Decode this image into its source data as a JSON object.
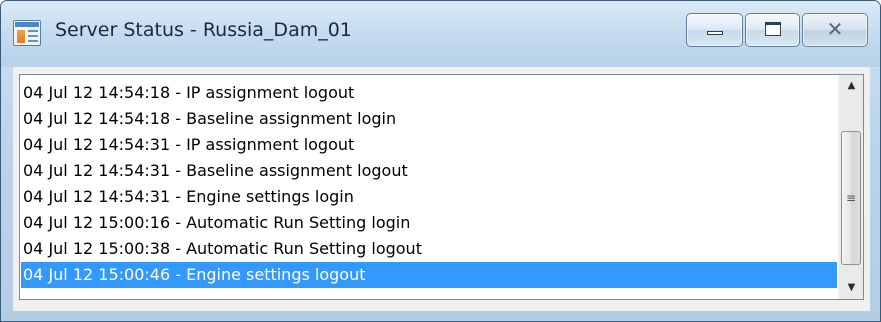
{
  "window": {
    "title": "Server Status - Russia_Dam_01",
    "icon": "application-window-icon",
    "controls": {
      "minimize_icon": "minimize-icon",
      "maximize_icon": "maximize-icon",
      "close_glyph": "✕"
    }
  },
  "log": {
    "items": [
      "04 Jul 12 14:54:18 - IP assignment logout",
      "04 Jul 12 14:54:18 - Baseline assignment login",
      "04 Jul 12 14:54:31 - IP assignment logout",
      "04 Jul 12 14:54:31 - Baseline assignment logout",
      "04 Jul 12 14:54:31 - Engine settings login",
      "04 Jul 12 15:00:16 - Automatic Run Setting login",
      "04 Jul 12 15:00:38 - Automatic Run Setting logout",
      "04 Jul 12 15:00:46 - Engine settings logout"
    ],
    "selected_index": 7
  },
  "scrollbar": {
    "up_glyph": "▲",
    "down_glyph": "▼",
    "grip_glyph": "≡"
  },
  "colors": {
    "selection": "#3399ff",
    "selection_text": "#ffffff",
    "titlebar": "#c6dcf0"
  }
}
